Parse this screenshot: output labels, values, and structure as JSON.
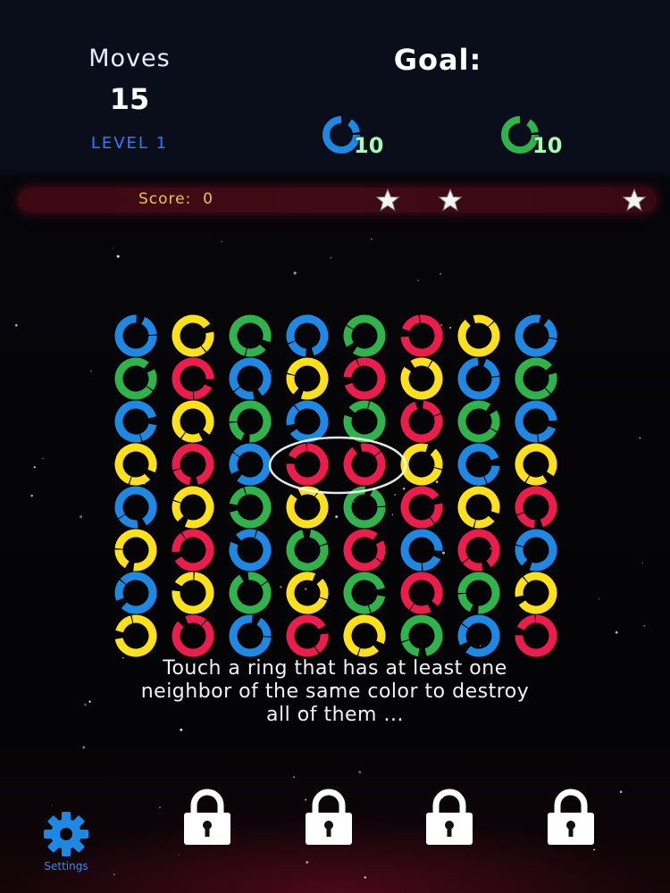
{
  "header": {
    "moves_label": "Moves",
    "moves_value": "15",
    "level_label": "LEVEL 1",
    "goal_label": "Goal:",
    "goals": [
      {
        "color": "blue",
        "count": "10"
      },
      {
        "color": "green",
        "count": "10"
      }
    ]
  },
  "score": {
    "label": "Score:",
    "value": "0",
    "stars_total": 3
  },
  "colors": {
    "blue": "#1e88e5",
    "yellow": "#ffe11a",
    "green": "#2fb34a",
    "red": "#ec1c4c",
    "accent_blue": "#2e7cff",
    "score_gold": "#f2c43a"
  },
  "board": {
    "columns": 8,
    "rows": 8,
    "grid": [
      [
        "blue",
        "yellow",
        "green",
        "blue",
        "green",
        "red",
        "yellow",
        "blue"
      ],
      [
        "green",
        "red",
        "blue",
        "yellow",
        "red",
        "yellow",
        "blue",
        "green"
      ],
      [
        "blue",
        "yellow",
        "green",
        "blue",
        "green",
        "red",
        "green",
        "blue"
      ],
      [
        "yellow",
        "red",
        "blue",
        "red",
        "red",
        "yellow",
        "blue",
        "yellow"
      ],
      [
        "blue",
        "yellow",
        "green",
        "yellow",
        "green",
        "red",
        "yellow",
        "red"
      ],
      [
        "yellow",
        "red",
        "blue",
        "green",
        "red",
        "blue",
        "red",
        "blue"
      ],
      [
        "blue",
        "yellow",
        "green",
        "yellow",
        "green",
        "red",
        "green",
        "yellow"
      ],
      [
        "yellow",
        "red",
        "blue",
        "red",
        "yellow",
        "green",
        "blue",
        "red"
      ]
    ],
    "selection": {
      "row": 3,
      "columns": [
        3,
        4
      ]
    }
  },
  "hint": {
    "lines": [
      "Touch a ring that has at least one",
      "neighbor of the same color to destroy",
      "all of them ..."
    ]
  },
  "footer": {
    "settings_label": "Settings",
    "settings_icon": "gear-icon",
    "lock_icon": "padlock-icon",
    "locked_slots": 4
  }
}
